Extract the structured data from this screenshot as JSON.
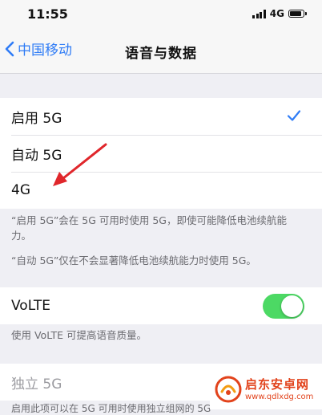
{
  "status_bar": {
    "time": "11:55",
    "network": "4G"
  },
  "nav": {
    "back_label": "中国移动",
    "title": "语音与数据"
  },
  "mode_options": [
    {
      "label": "启用 5G",
      "selected": true
    },
    {
      "label": "自动 5G",
      "selected": false
    },
    {
      "label": "4G",
      "selected": false
    }
  ],
  "notes": {
    "enable_5g": "“启用 5G”会在 5G 可用时使用 5G，即使可能降低电池续航能力。",
    "auto_5g": "“自动 5G”仅在不会显著降低电池续航能力时使用 5G。",
    "volte": "使用 VoLTE 可提高语音质量。",
    "standalone": "启用此项可以在 5G 可用时使用独立组网的 5G"
  },
  "volte": {
    "label": "VoLTE",
    "enabled": true
  },
  "standalone_5g": {
    "label": "独立 5G"
  },
  "watermark": {
    "title": "启东安卓网",
    "url": "www.qdlxdg.com"
  },
  "colors": {
    "accent": "#2f7cf6",
    "toggle_on": "#4cd964",
    "annotation_arrow": "#e0262b",
    "watermark": "#e2431c"
  }
}
